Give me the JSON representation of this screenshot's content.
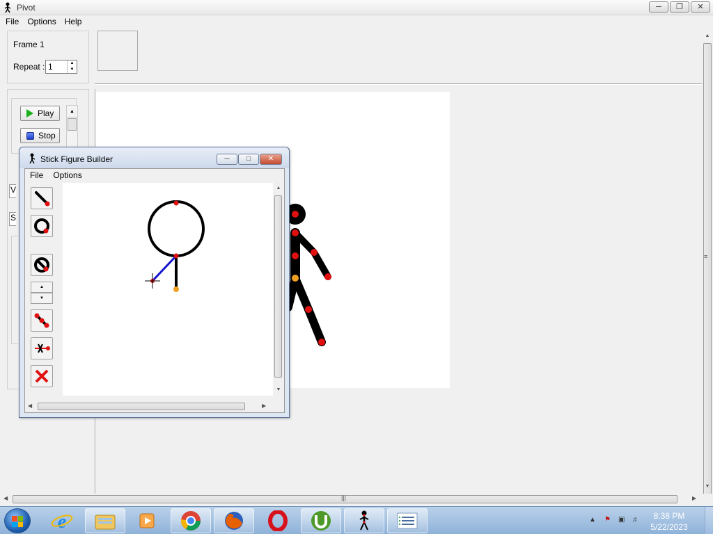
{
  "window": {
    "title": "Pivot",
    "menu": [
      "File",
      "Options",
      "Help"
    ]
  },
  "frame_panel": {
    "frame_label": "Frame 1",
    "repeat_label": "Repeat :",
    "repeat_value": "1"
  },
  "playback": {
    "play_label": "Play",
    "stop_label": "Stop"
  },
  "left_partial": {
    "top": "V",
    "bottom": "S"
  },
  "builder": {
    "title": "Stick Figure Builder",
    "menu": [
      "File",
      "Options"
    ],
    "tools": [
      "add-line-tool",
      "add-circle-tool",
      "circle-toggle-tool",
      "thickness-spinner",
      "duplicate-segment-tool",
      "static-segment-tool",
      "delete-tool"
    ]
  },
  "taskbar": {
    "apps": [
      "internet-explorer",
      "file-explorer",
      "media-player",
      "chrome",
      "firefox",
      "opera",
      "utorrent",
      "pivot",
      "notes"
    ],
    "time": "8:38 PM",
    "date": "5/22/2023"
  },
  "colors": {
    "joint_red": "#e01010",
    "joint_orange": "#f0a020",
    "selected_segment": "#1515d0",
    "stick_black": "#000000"
  }
}
